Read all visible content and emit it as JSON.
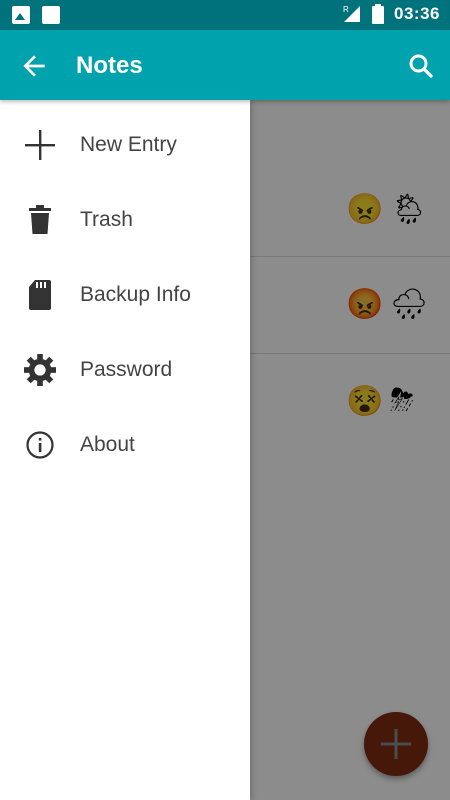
{
  "status_bar": {
    "time": "03:36",
    "icons": [
      "image-notification-icon",
      "app-notification-icon",
      "signal-icon",
      "battery-icon"
    ]
  },
  "app_bar": {
    "title": "Notes",
    "back_icon": "arrow-left-icon",
    "search_icon": "search-icon"
  },
  "drawer": {
    "items": [
      {
        "label": "New Entry",
        "icon": "plus-icon"
      },
      {
        "label": "Trash",
        "icon": "trash-icon"
      },
      {
        "label": "Backup Info",
        "icon": "sd-card-icon"
      },
      {
        "label": "Password",
        "icon": "gear-icon"
      },
      {
        "label": "About",
        "icon": "info-icon"
      }
    ]
  },
  "entries": [
    {
      "mood": "😠",
      "weather": "🌦"
    },
    {
      "mood": "😡",
      "weather": "🌧"
    },
    {
      "mood": "😵",
      "weather": "⛈"
    }
  ],
  "fab": {
    "icon": "plus-icon"
  },
  "colors": {
    "status_bar": "#00727c",
    "app_bar": "#00a2ad",
    "fab": "#e7501f"
  }
}
